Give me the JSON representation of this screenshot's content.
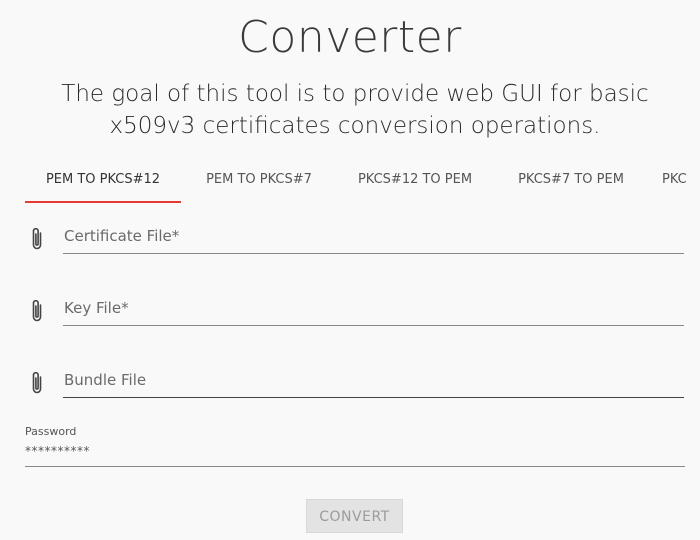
{
  "header": {
    "title": "Converter",
    "subtitle": "The goal of this tool is to provide web GUI for basic x509v3 certificates conversion operations."
  },
  "tabs": [
    {
      "label": "PEM TO PKCS#12",
      "active": true
    },
    {
      "label": "PEM TO PKCS#7",
      "active": false
    },
    {
      "label": "PKCS#12 TO PEM",
      "active": false
    },
    {
      "label": "PKCS#7 TO PEM",
      "active": false
    },
    {
      "label": "PKC",
      "active": false
    }
  ],
  "form": {
    "certificate_file": {
      "placeholder": "Certificate File*",
      "icon": "paperclip-icon"
    },
    "key_file": {
      "placeholder": "Key File*",
      "icon": "paperclip-icon"
    },
    "bundle_file": {
      "placeholder": "Bundle File",
      "icon": "paperclip-icon"
    },
    "password": {
      "label": "Password",
      "value": "**********"
    },
    "convert_label": "CONVERT"
  },
  "colors": {
    "active_tab_underline": "#e53935",
    "background": "#f9f9f9",
    "button_disabled_bg": "#e3e3e3"
  }
}
